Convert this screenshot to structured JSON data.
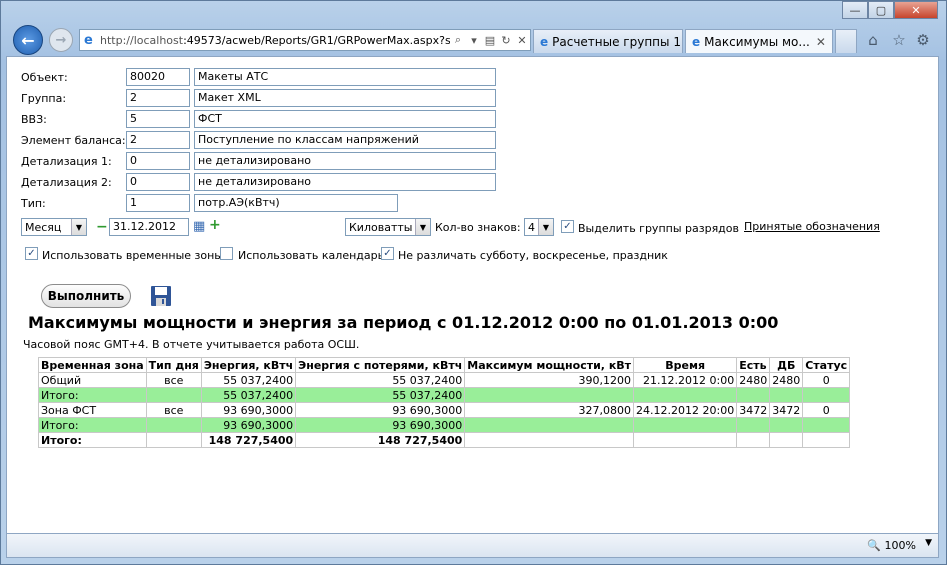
{
  "browser": {
    "url_prefix": "http://localhost",
    "url_rest": ":49573/acweb/Reports/GR1/GRPowerMax.aspx?s",
    "tabs": [
      {
        "label": "Расчетные группы 1..."
      },
      {
        "label": "Максимумы мо..."
      }
    ],
    "zoom": "100%"
  },
  "form": {
    "rows": [
      {
        "label": "Объект:",
        "code": "80020",
        "name": "Макеты АТС"
      },
      {
        "label": "Группа:",
        "code": "2",
        "name": "Макет XML"
      },
      {
        "label": "ВВЗ:",
        "code": "5",
        "name": "ФСТ"
      },
      {
        "label": "Элемент баланса:",
        "code": "2",
        "name": "Поступление по классам напряжений"
      },
      {
        "label": "Детализация 1:",
        "code": "0",
        "name": "не детализировано"
      },
      {
        "label": "Детализация 2:",
        "code": "0",
        "name": "не детализировано"
      },
      {
        "label": "Тип:",
        "code": "1",
        "name": "потр.АЭ(кВтч)"
      }
    ],
    "period_select": "Месяц",
    "date": "31.12.2012",
    "units_select": "Киловатты",
    "digits_label": "Кол-во знаков:",
    "digits_value": "4",
    "group_digits_label": "Выделить группы разрядов",
    "legend_link": "Принятые обозначения",
    "use_time_zones_label": "Использовать временные зоны",
    "use_calendar_label": "Использовать календарь",
    "no_distinguish_label": "Не различать субботу, воскресенье, праздник",
    "run_button": "Выполнить"
  },
  "report": {
    "title": "Максимумы мощности и энергия за период с 01.12.2012 0:00 по 01.01.2013 0:00",
    "note": "Часовой пояс GMT+4. В отчете учитывается работа ОСШ.",
    "columns": [
      "Временная зона",
      "Тип дня",
      "Энергия, кВтч",
      "Энергия с потерями, кВтч",
      "Максимум мощности, кВт",
      "Время",
      "Есть",
      "ДБ",
      "Статус"
    ],
    "rows": [
      {
        "zone": "Общий",
        "day": "все",
        "energy": "55 037,2400",
        "energy_loss": "55 037,2400",
        "max": "390,1200",
        "time": "21.12.2012 0:00",
        "has": "2480",
        "db": "2480",
        "status": "0"
      },
      {
        "zone": "Итого:",
        "day": "",
        "energy": "55 037,2400",
        "energy_loss": "55 037,2400",
        "max": "",
        "time": "",
        "has": "",
        "db": "",
        "status": ""
      },
      {
        "zone": "Зона ФСТ",
        "day": "все",
        "energy": "93 690,3000",
        "energy_loss": "93 690,3000",
        "max": "327,0800",
        "time": "24.12.2012 20:00",
        "has": "3472",
        "db": "3472",
        "status": "0"
      },
      {
        "zone": "Итого:",
        "day": "",
        "energy": "93 690,3000",
        "energy_loss": "93 690,3000",
        "max": "",
        "time": "",
        "has": "",
        "db": "",
        "status": ""
      },
      {
        "zone": "Итого:",
        "day": "",
        "energy": "148 727,5400",
        "energy_loss": "148 727,5400",
        "max": "",
        "time": "",
        "has": "",
        "db": "",
        "status": ""
      }
    ]
  }
}
